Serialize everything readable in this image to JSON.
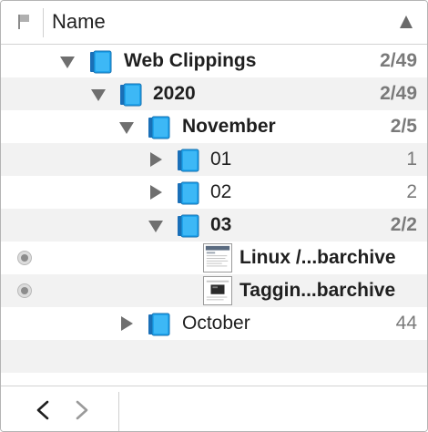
{
  "header": {
    "name_label": "Name",
    "sort_direction": "ascending"
  },
  "rows": [
    {
      "label": "Web Clippings",
      "count": "2/49",
      "bold": true,
      "expanded": true,
      "icon": "group-icon"
    },
    {
      "label": "2020",
      "count": "2/49",
      "bold": true,
      "expanded": true,
      "icon": "group-icon"
    },
    {
      "label": "November",
      "count": "2/5",
      "bold": true,
      "expanded": true,
      "icon": "group-icon"
    },
    {
      "label": "01",
      "count": "1",
      "bold": false,
      "expanded": false,
      "icon": "group-icon"
    },
    {
      "label": "02",
      "count": "2",
      "bold": false,
      "expanded": false,
      "icon": "group-icon"
    },
    {
      "label": "03",
      "count": "2/2",
      "bold": true,
      "expanded": true,
      "icon": "group-icon"
    },
    {
      "label": "Linux /...barchive",
      "count": "",
      "bold": true,
      "icon": "webarchive-thumbnail"
    },
    {
      "label": "Taggin...barchive",
      "count": "",
      "bold": true,
      "icon": "webarchive-thumbnail"
    },
    {
      "label": "October",
      "count": "44",
      "bold": false,
      "expanded": false,
      "icon": "group-icon"
    }
  ],
  "colors": {
    "folder_blue": "#1a9ee8",
    "folder_light": "#38b6f5",
    "stripe": "#f2f2f2",
    "count_gray": "#7a7a7a"
  },
  "toolbar": {
    "back_icon": "chevron-left-icon",
    "forward_icon": "chevron-right-icon"
  }
}
